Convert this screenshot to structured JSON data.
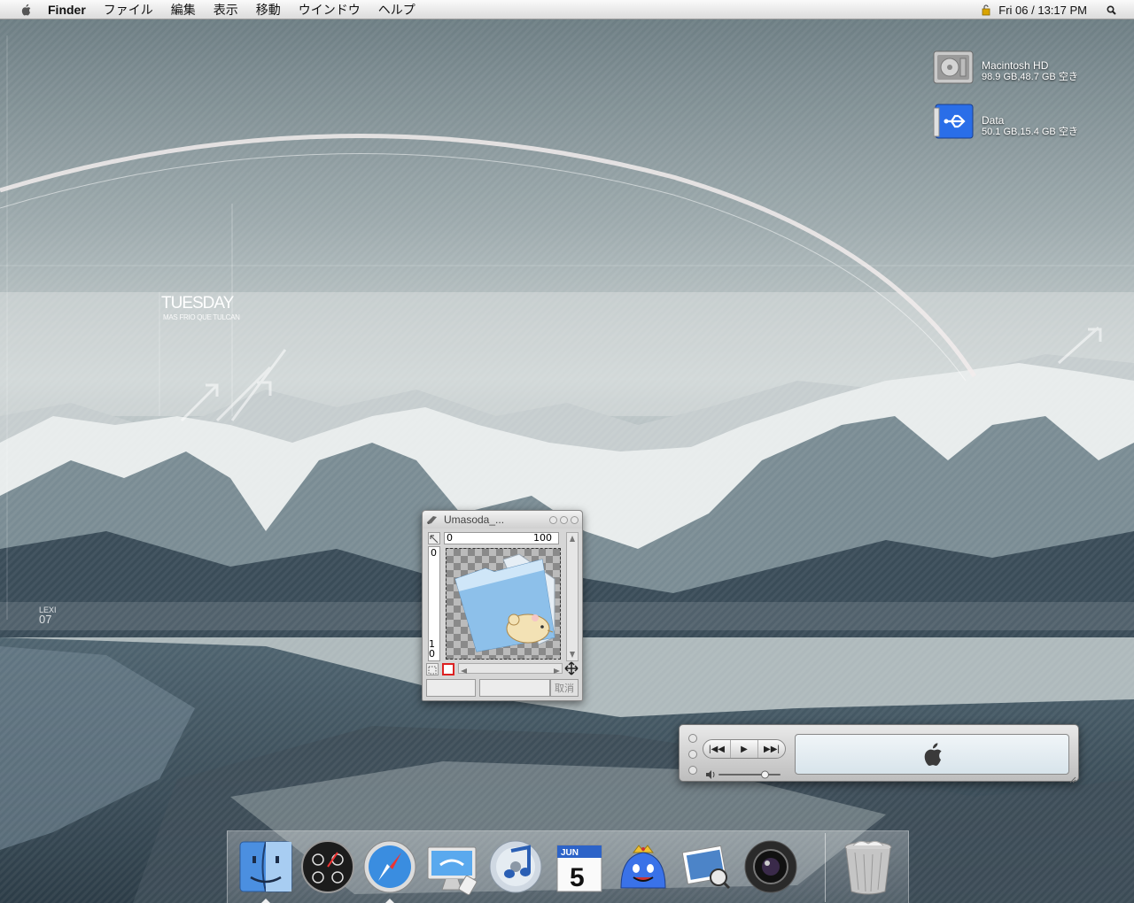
{
  "menubar": {
    "apple_icon": "apple-icon",
    "app_name": "Finder",
    "items": [
      "ファイル",
      "編集",
      "表示",
      "移動",
      "ウインドウ",
      "ヘルプ"
    ],
    "clock": "Fri 06 / 13:17 PM",
    "status_icon": "spotlight-search-icon"
  },
  "desktop": {
    "icons": [
      {
        "name": "Macintosh HD",
        "info": "98.9 GB,48.7 GB 空き",
        "icon": "hard-drive-icon"
      },
      {
        "name": "Data",
        "info": "50.1 GB,15.4 GB 空き",
        "icon": "usb-drive-icon"
      }
    ],
    "wallpaper": {
      "day": "TUESDAY",
      "tagline": "MAS FRIO QUE TULCAN",
      "lexi": "LEXI",
      "number": "07"
    }
  },
  "editor": {
    "title": "Umasoda_...",
    "ruler_h_start": "0",
    "ruler_h_end": "100",
    "ruler_v_start": "0",
    "ruler_v_end": "10",
    "cancel_label": "取消",
    "image_icon": "folder-with-hamster-icon"
  },
  "itunes": {
    "controls": [
      "|◀◀",
      "▶",
      "▶▶|"
    ],
    "display_icon": "apple-logo-icon",
    "volume": 0.75
  },
  "dock": {
    "items": [
      "finder",
      "dashboard",
      "safari",
      "mail",
      "itunes",
      "ical",
      "slime",
      "preview",
      "photo-booth"
    ],
    "ical_month": "JUN",
    "ical_day": "5",
    "trash": "trash"
  }
}
